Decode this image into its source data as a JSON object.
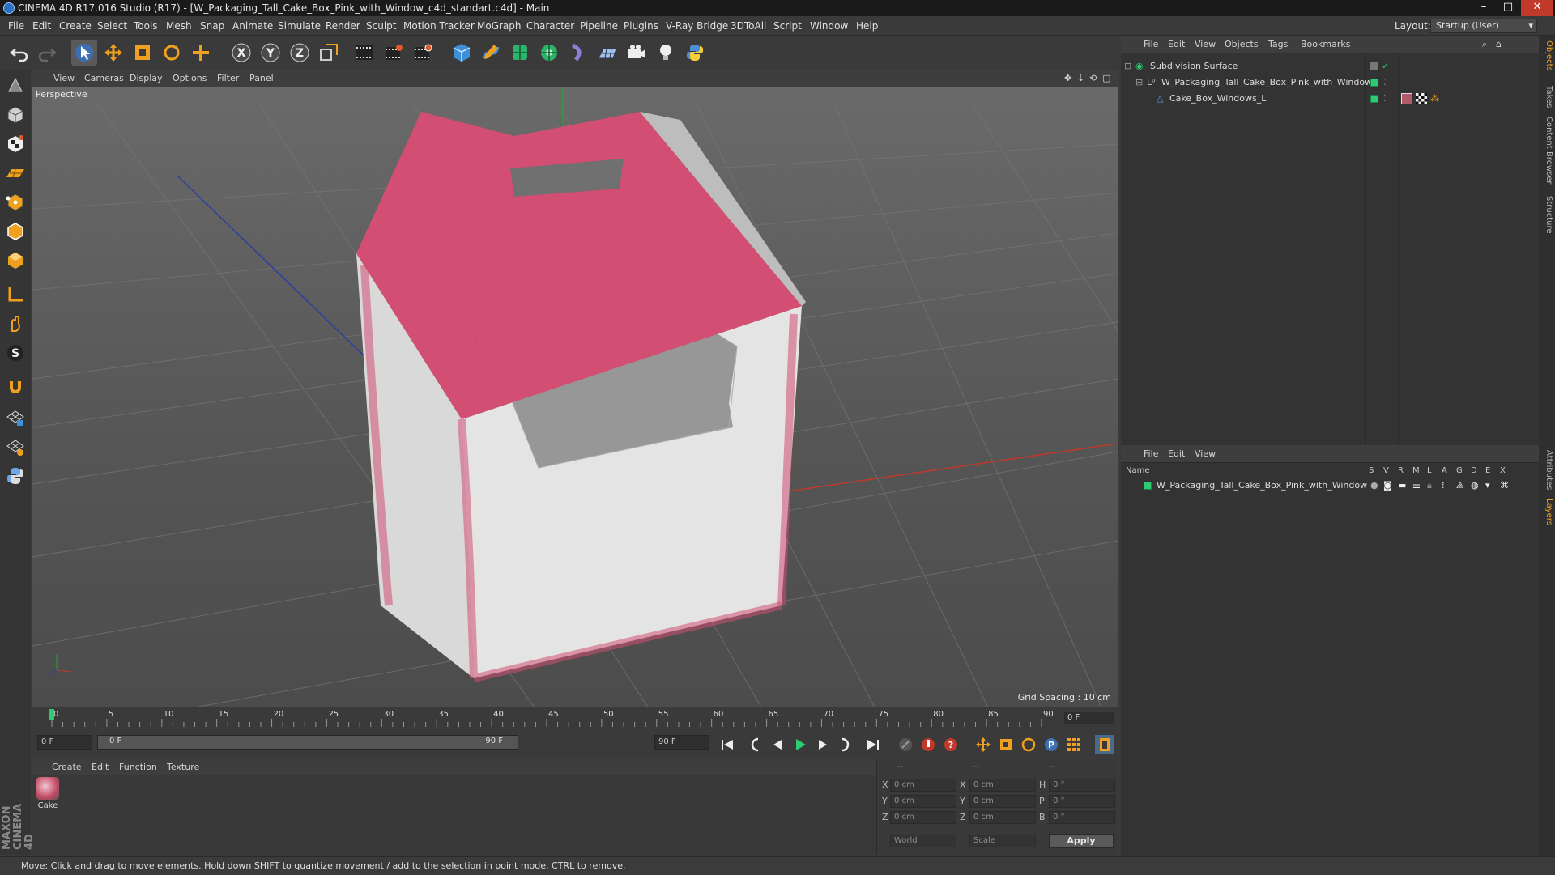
{
  "window": {
    "title": "CINEMA 4D R17.016 Studio (R17) - [W_Packaging_Tall_Cake_Box_Pink_with_Window_c4d_standart.c4d] - Main",
    "controls": [
      "–",
      "□",
      "✕"
    ]
  },
  "menubar": {
    "items": [
      "File",
      "Edit",
      "Create",
      "Select",
      "Tools",
      "Mesh",
      "Snap",
      "Animate",
      "Simulate",
      "Render",
      "Sculpt",
      "Motion Tracker",
      "MoGraph",
      "Character",
      "Pipeline",
      "Plugins",
      "V-Ray Bridge",
      "3DToAll",
      "Script",
      "Window",
      "Help"
    ],
    "layout_label": "Layout:",
    "layout_value": "Startup (User)"
  },
  "toolbar": {
    "icons": [
      "undo-icon",
      "redo-icon",
      "select-arrow-icon",
      "move-icon",
      "scale-icon",
      "rotate-icon",
      "move-plus-icon",
      "x-axis-icon",
      "y-axis-icon",
      "z-axis-icon",
      "coordinate-system-icon",
      "render-view-icon",
      "render-picture-viewer-icon",
      "render-settings-icon",
      "cube-icon",
      "pen-spline-icon",
      "subdivision-icon",
      "array-icon",
      "deformer-icon",
      "floor-icon",
      "camera-icon",
      "light-icon",
      "python-icon"
    ],
    "axis_labels": [
      "X",
      "Y",
      "Z"
    ]
  },
  "left_tools": [
    "make-editable-icon",
    "model-mode-icon",
    "texture-mode-icon",
    "workplane-icon",
    "points-mode-icon",
    "edges-mode-icon",
    "polygons-mode-icon",
    "axis-mode-icon",
    "tweak-icon",
    "snap-s-icon",
    "magnet-icon",
    "grid-lock-icon",
    "grid-snap-icon",
    "python-script-icon"
  ],
  "branding": "MAXON CINEMA 4D",
  "viewport": {
    "menu": [
      "View",
      "Cameras",
      "Display",
      "Options",
      "Filter",
      "Panel"
    ],
    "label": "Perspective",
    "grid_spacing": "Grid Spacing : 10 cm"
  },
  "timeline": {
    "ticks": [
      "0",
      "5",
      "10",
      "15",
      "20",
      "25",
      "30",
      "35",
      "40",
      "45",
      "50",
      "55",
      "60",
      "65",
      "70",
      "75",
      "80",
      "85",
      "90"
    ],
    "current_frame_display": "0 F",
    "start_field": "0 F",
    "range_start": "0 F",
    "range_end": "90 F",
    "end_field": "90 F"
  },
  "material_manager": {
    "menu": [
      "Create",
      "Edit",
      "Function",
      "Texture"
    ],
    "materials": [
      {
        "name": "Cake"
      }
    ]
  },
  "coordinates": {
    "header": [
      "--",
      "--",
      "--"
    ],
    "rows": [
      {
        "axis": "X",
        "pos": "0 cm",
        "axis2": "X",
        "size": "0 cm",
        "rot_label": "H",
        "rot": "0 °"
      },
      {
        "axis": "Y",
        "pos": "0 cm",
        "axis2": "Y",
        "size": "0 cm",
        "rot_label": "P",
        "rot": "0 °"
      },
      {
        "axis": "Z",
        "pos": "0 cm",
        "axis2": "Z",
        "size": "0 cm",
        "rot_label": "B",
        "rot": "0 °"
      }
    ],
    "mode_select": "World",
    "scale_select": "Scale",
    "apply_label": "Apply"
  },
  "object_manager": {
    "menu": [
      "File",
      "Edit",
      "View",
      "Objects",
      "Tags",
      "Bookmarks"
    ],
    "objects": [
      {
        "name": "Subdivision Surface",
        "level": 0
      },
      {
        "name": "W_Packaging_Tall_Cake_Box_Pink_with_Window",
        "level": 1
      },
      {
        "name": "Cake_Box_Windows_L",
        "level": 2
      }
    ]
  },
  "layer_manager": {
    "menu": [
      "File",
      "Edit",
      "View"
    ],
    "columns": [
      "Name",
      "S",
      "V",
      "R",
      "M",
      "L",
      "A",
      "G",
      "D",
      "E",
      "X"
    ],
    "layers": [
      {
        "name": "W_Packaging_Tall_Cake_Box_Pink_with_Window"
      }
    ]
  },
  "side_tabs": [
    "Objects",
    "Takes",
    "Content Browser",
    "Structure",
    "Attributes",
    "Layers"
  ],
  "status": "Move: Click and drag to move elements. Hold down SHIFT to quantize movement / add to the selection in point mode, CTRL to remove.",
  "colors": {
    "accent_green": "#2ecc71",
    "box_pink": "#d24e72",
    "axis_red": "#c0392b",
    "axis_blue": "#2c3e9e"
  }
}
